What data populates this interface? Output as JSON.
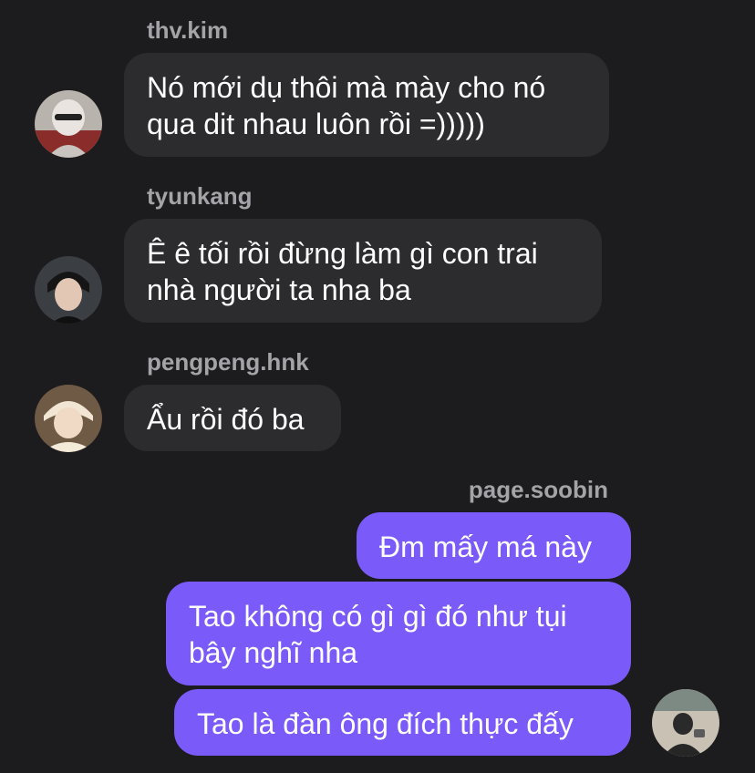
{
  "messages": [
    {
      "sender": "thv.kim",
      "avatar_icon": "user-avatar-icon",
      "lines": [
        "Nó mới dụ thôi mà mày cho nó",
        "qua dit nhau luôn rồi =)))))"
      ]
    },
    {
      "sender": "tyunkang",
      "avatar_icon": "user-avatar-icon",
      "lines": [
        "Ê ê tối rồi đừng làm gì con trai",
        "nhà người ta nha ba"
      ]
    },
    {
      "sender": "pengpeng.hnk",
      "avatar_icon": "user-avatar-icon",
      "lines": [
        "Ẩu rồi đó ba"
      ]
    }
  ],
  "own": {
    "sender": "page.soobin",
    "avatar_icon": "user-avatar-icon",
    "bubbles": [
      {
        "lines": [
          "Đm mấy má này"
        ]
      },
      {
        "lines": [
          "Tao không có gì gì đó như tụi",
          "bây nghĩ nha"
        ]
      },
      {
        "lines": [
          "Tao là đàn ông đích thực đấy"
        ]
      }
    ]
  },
  "colors": {
    "background": "#1c1b1d",
    "incoming_bubble": "#2c2b2e",
    "outgoing_bubble": "#7a5af8",
    "sender_name": "#a3a3a8",
    "message_text": "#ffffff"
  }
}
